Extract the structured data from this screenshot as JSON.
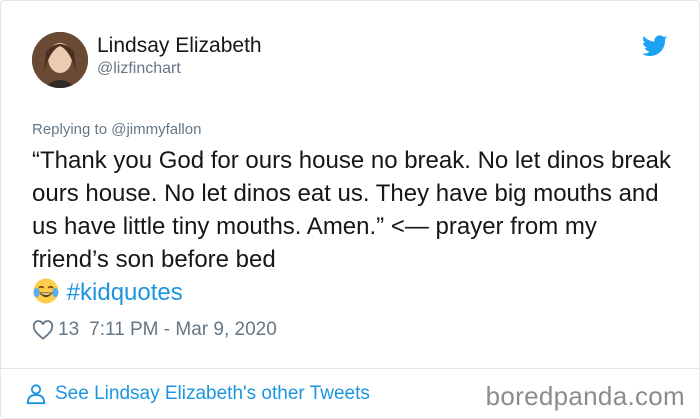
{
  "author": {
    "display_name": "Lindsay Elizabeth",
    "handle": "@lizfinchart"
  },
  "reply": {
    "text": "Replying to @jimmyfallon"
  },
  "tweet": {
    "text": "“Thank you God for ours house no break. No let dinos break ours house. No let dinos eat us. They have big mouths and us have little tiny mouths. Amen.” <— prayer from my friend’s son before bed",
    "emoji": "laughing-tears",
    "hashtag": "#kidquotes"
  },
  "meta": {
    "likes": "13",
    "timestamp": "7:11 PM - Mar 9, 2020"
  },
  "footer": {
    "see_more": "See Lindsay Elizabeth's other Tweets",
    "watermark": "boredpanda.com"
  },
  "colors": {
    "link": "#1b95e0",
    "muted": "#657786",
    "text": "#14171a"
  }
}
